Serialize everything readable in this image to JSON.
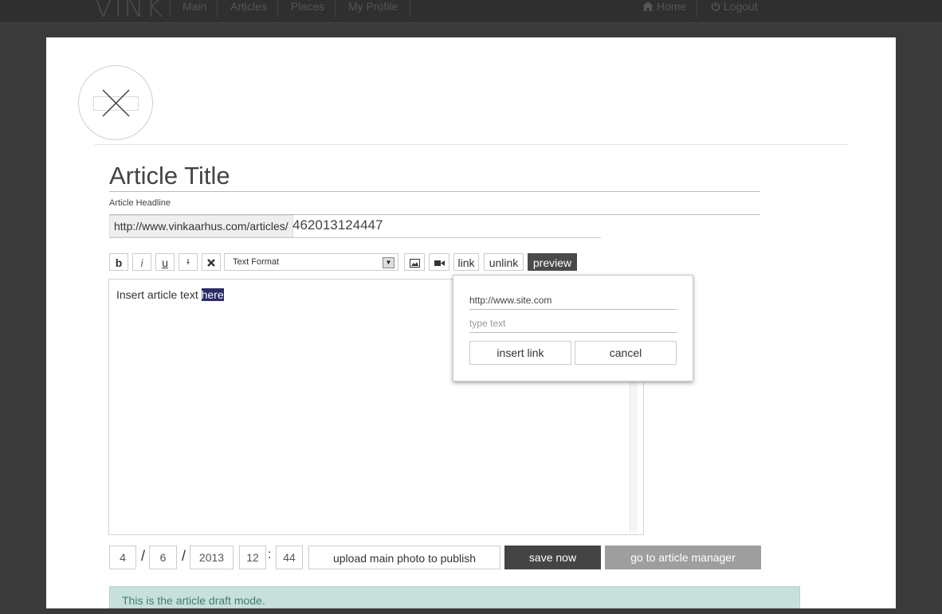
{
  "nav": {
    "logo": "VINK",
    "items": [
      {
        "label": "Main"
      },
      {
        "label": "Articles"
      },
      {
        "label": "Places"
      },
      {
        "label": "My Profile"
      }
    ],
    "home": "Home",
    "logout": "Logout"
  },
  "article": {
    "title": "Article Title",
    "headline_placeholder": "Article Headline",
    "url_prefix": "http://www.vinkaarhus.com/articles/",
    "url_id": "462013124447"
  },
  "toolbar": {
    "bold": "b",
    "italic": "i",
    "underline": "u",
    "strike": "I",
    "format_select": "Text Format",
    "link": "link",
    "unlink": "unlink",
    "preview": "preview"
  },
  "editor": {
    "text_before": "Insert article text ",
    "text_selected": "here"
  },
  "link_popup": {
    "url_value": "http://www.site.com",
    "text_placeholder": "type text",
    "insert_label": "insert link",
    "cancel_label": "cancel"
  },
  "publish": {
    "day": "4",
    "month": "6",
    "year": "2013",
    "hour": "12",
    "minute": "44",
    "date_sep": "/",
    "time_sep": ":",
    "upload_label": "upload main photo to publish",
    "save_label": "save now",
    "manager_label": "go to article manager"
  },
  "status": {
    "draft_message": "This is the article draft mode."
  }
}
